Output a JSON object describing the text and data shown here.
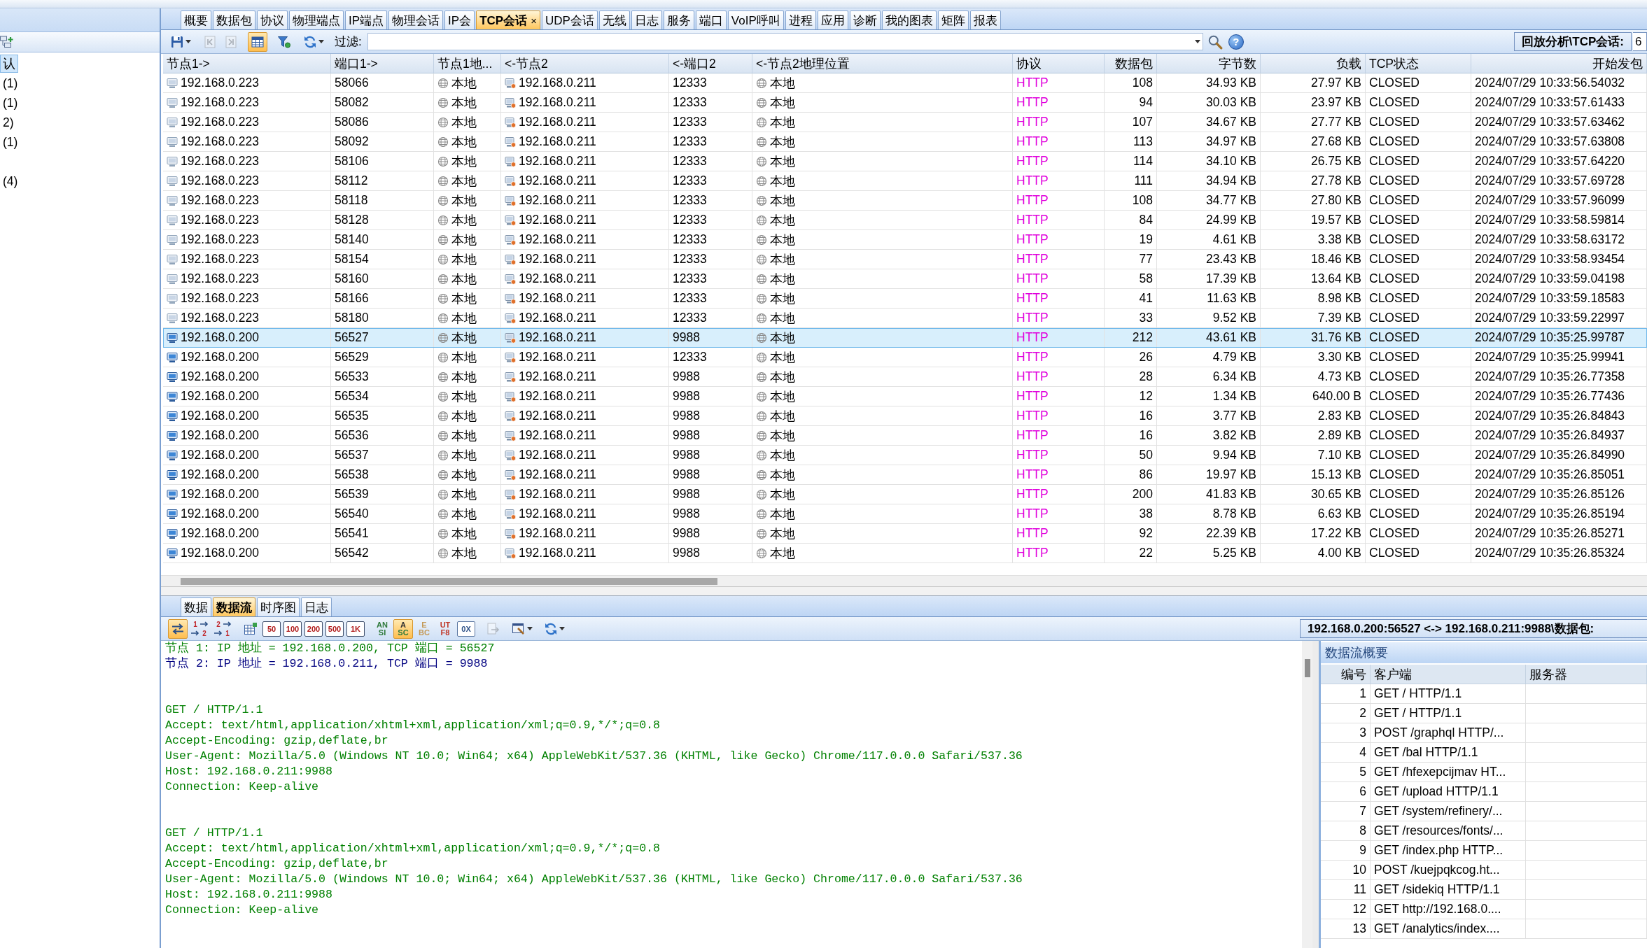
{
  "sidebar": {
    "items": [
      {
        "label": "认",
        "selected": true
      },
      {
        "label": "(1)",
        "selected": false
      },
      {
        "label": "(1)",
        "selected": false
      },
      {
        "label": "2)",
        "selected": false
      },
      {
        "label": "(1)",
        "selected": false
      },
      {
        "selected": false
      },
      {
        "label": "(4)",
        "selected": false
      }
    ]
  },
  "tabs": [
    {
      "label": "概要",
      "selected": false
    },
    {
      "label": "数据包",
      "selected": false
    },
    {
      "label": "协议",
      "selected": false
    },
    {
      "label": "物理端点",
      "selected": false
    },
    {
      "label": "IP端点",
      "selected": false
    },
    {
      "label": "物理会话",
      "selected": false
    },
    {
      "label": "IP会",
      "selected": false
    },
    {
      "label": "TCP会话",
      "selected": true,
      "close": "×"
    },
    {
      "label": "UDP会话",
      "selected": false
    },
    {
      "label": "无线",
      "selected": false
    },
    {
      "label": "日志",
      "selected": false
    },
    {
      "label": "服务",
      "selected": false
    },
    {
      "label": "端口",
      "selected": false
    },
    {
      "label": "VoIP呼叫",
      "selected": false
    },
    {
      "label": "进程",
      "selected": false
    },
    {
      "label": "应用",
      "selected": false
    },
    {
      "label": "诊断",
      "selected": false
    },
    {
      "label": "我的图表",
      "selected": false
    },
    {
      "label": "矩阵",
      "selected": false
    },
    {
      "label": "报表",
      "selected": false
    }
  ],
  "toolbar": {
    "buttons": [
      {
        "kind": "save",
        "on": false,
        "disabled": false
      },
      {
        "kind": "back",
        "on": false,
        "disabled": true
      },
      {
        "kind": "forward",
        "on": false,
        "disabled": true
      },
      {
        "kind": "table",
        "on": true,
        "disabled": false
      },
      {
        "kind": "filter",
        "on": false,
        "disabled": false
      },
      {
        "kind": "refresh",
        "on": false,
        "disabled": false
      }
    ],
    "filter_label": "过滤:",
    "tools": [
      {
        "kind": "search"
      },
      {
        "kind": "help",
        "label": "?"
      }
    ],
    "path": "回放分析\\TCP会话:",
    "value": "6"
  },
  "table": {
    "columns": [
      {
        "label": "节点1->",
        "kind": "source"
      },
      {
        "label": "端口1->",
        "kind": "port"
      },
      {
        "label": "节点1地...",
        "kind": "location"
      },
      {
        "label": "<-节点2",
        "kind": "target"
      },
      {
        "label": "<-端口2",
        "kind": "port"
      },
      {
        "label": "<-节点2地理位置",
        "kind": "location"
      },
      {
        "label": "协议",
        "kind": "protocol"
      },
      {
        "label": "数据包",
        "kind": "count"
      },
      {
        "label": "字节数",
        "kind": "count"
      },
      {
        "label": "负载",
        "kind": "count"
      },
      {
        "label": "TCP状态",
        "kind": "state"
      },
      {
        "label": "开始发包",
        "kind": "time"
      }
    ],
    "rows": [
      {
        "kind": "remote",
        "selected": false,
        "cells": [
          "192.168.0.223",
          "58066",
          "本地",
          "192.168.0.211",
          "12333",
          "本地",
          "HTTP",
          "108",
          "34.93 KB",
          "27.97 KB",
          "CLOSED",
          "2024/07/29 10:33:56.54032"
        ]
      },
      {
        "kind": "remote",
        "selected": false,
        "cells": [
          "192.168.0.223",
          "58082",
          "本地",
          "192.168.0.211",
          "12333",
          "本地",
          "HTTP",
          "94",
          "30.03 KB",
          "23.97 KB",
          "CLOSED",
          "2024/07/29 10:33:57.61433"
        ]
      },
      {
        "kind": "remote",
        "selected": false,
        "cells": [
          "192.168.0.223",
          "58086",
          "本地",
          "192.168.0.211",
          "12333",
          "本地",
          "HTTP",
          "107",
          "34.67 KB",
          "27.77 KB",
          "CLOSED",
          "2024/07/29 10:33:57.63462"
        ]
      },
      {
        "kind": "remote",
        "selected": false,
        "cells": [
          "192.168.0.223",
          "58092",
          "本地",
          "192.168.0.211",
          "12333",
          "本地",
          "HTTP",
          "113",
          "34.97 KB",
          "27.68 KB",
          "CLOSED",
          "2024/07/29 10:33:57.63808"
        ]
      },
      {
        "kind": "remote",
        "selected": false,
        "cells": [
          "192.168.0.223",
          "58106",
          "本地",
          "192.168.0.211",
          "12333",
          "本地",
          "HTTP",
          "114",
          "34.10 KB",
          "26.75 KB",
          "CLOSED",
          "2024/07/29 10:33:57.64220"
        ]
      },
      {
        "kind": "remote",
        "selected": false,
        "cells": [
          "192.168.0.223",
          "58112",
          "本地",
          "192.168.0.211",
          "12333",
          "本地",
          "HTTP",
          "111",
          "34.94 KB",
          "27.78 KB",
          "CLOSED",
          "2024/07/29 10:33:57.69728"
        ]
      },
      {
        "kind": "remote",
        "selected": false,
        "cells": [
          "192.168.0.223",
          "58118",
          "本地",
          "192.168.0.211",
          "12333",
          "本地",
          "HTTP",
          "108",
          "34.77 KB",
          "27.80 KB",
          "CLOSED",
          "2024/07/29 10:33:57.96099"
        ]
      },
      {
        "kind": "remote",
        "selected": false,
        "cells": [
          "192.168.0.223",
          "58128",
          "本地",
          "192.168.0.211",
          "12333",
          "本地",
          "HTTP",
          "84",
          "24.99 KB",
          "19.57 KB",
          "CLOSED",
          "2024/07/29 10:33:58.59814"
        ]
      },
      {
        "kind": "remote",
        "selected": false,
        "cells": [
          "192.168.0.223",
          "58140",
          "本地",
          "192.168.0.211",
          "12333",
          "本地",
          "HTTP",
          "19",
          "4.61 KB",
          "3.38 KB",
          "CLOSED",
          "2024/07/29 10:33:58.63172"
        ]
      },
      {
        "kind": "remote",
        "selected": false,
        "cells": [
          "192.168.0.223",
          "58154",
          "本地",
          "192.168.0.211",
          "12333",
          "本地",
          "HTTP",
          "77",
          "23.43 KB",
          "18.46 KB",
          "CLOSED",
          "2024/07/29 10:33:58.93454"
        ]
      },
      {
        "kind": "remote",
        "selected": false,
        "cells": [
          "192.168.0.223",
          "58160",
          "本地",
          "192.168.0.211",
          "12333",
          "本地",
          "HTTP",
          "58",
          "17.39 KB",
          "13.64 KB",
          "CLOSED",
          "2024/07/29 10:33:59.04198"
        ]
      },
      {
        "kind": "remote",
        "selected": false,
        "cells": [
          "192.168.0.223",
          "58166",
          "本地",
          "192.168.0.211",
          "12333",
          "本地",
          "HTTP",
          "41",
          "11.63 KB",
          "8.98 KB",
          "CLOSED",
          "2024/07/29 10:33:59.18583"
        ]
      },
      {
        "kind": "remote",
        "selected": false,
        "cells": [
          "192.168.0.223",
          "58180",
          "本地",
          "192.168.0.211",
          "12333",
          "本地",
          "HTTP",
          "33",
          "9.52 KB",
          "7.39 KB",
          "CLOSED",
          "2024/07/29 10:33:59.22997"
        ]
      },
      {
        "kind": "local",
        "selected": true,
        "cells": [
          "192.168.0.200",
          "56527",
          "本地",
          "192.168.0.211",
          "9988",
          "本地",
          "HTTP",
          "212",
          "43.61 KB",
          "31.76 KB",
          "CLOSED",
          "2024/07/29 10:35:25.99787"
        ]
      },
      {
        "kind": "local",
        "selected": false,
        "cells": [
          "192.168.0.200",
          "56529",
          "本地",
          "192.168.0.211",
          "12333",
          "本地",
          "HTTP",
          "26",
          "4.79 KB",
          "3.30 KB",
          "CLOSED",
          "2024/07/29 10:35:25.99941"
        ]
      },
      {
        "kind": "local",
        "selected": false,
        "cells": [
          "192.168.0.200",
          "56533",
          "本地",
          "192.168.0.211",
          "9988",
          "本地",
          "HTTP",
          "28",
          "6.34 KB",
          "4.73 KB",
          "CLOSED",
          "2024/07/29 10:35:26.77358"
        ]
      },
      {
        "kind": "local",
        "selected": false,
        "cells": [
          "192.168.0.200",
          "56534",
          "本地",
          "192.168.0.211",
          "9988",
          "本地",
          "HTTP",
          "12",
          "1.34 KB",
          "640.00 B",
          "CLOSED",
          "2024/07/29 10:35:26.77436"
        ]
      },
      {
        "kind": "local",
        "selected": false,
        "cells": [
          "192.168.0.200",
          "56535",
          "本地",
          "192.168.0.211",
          "9988",
          "本地",
          "HTTP",
          "16",
          "3.77 KB",
          "2.83 KB",
          "CLOSED",
          "2024/07/29 10:35:26.84843"
        ]
      },
      {
        "kind": "local",
        "selected": false,
        "cells": [
          "192.168.0.200",
          "56536",
          "本地",
          "192.168.0.211",
          "9988",
          "本地",
          "HTTP",
          "16",
          "3.82 KB",
          "2.89 KB",
          "CLOSED",
          "2024/07/29 10:35:26.84937"
        ]
      },
      {
        "kind": "local",
        "selected": false,
        "cells": [
          "192.168.0.200",
          "56537",
          "本地",
          "192.168.0.211",
          "9988",
          "本地",
          "HTTP",
          "50",
          "9.94 KB",
          "7.10 KB",
          "CLOSED",
          "2024/07/29 10:35:26.84990"
        ]
      },
      {
        "kind": "local",
        "selected": false,
        "cells": [
          "192.168.0.200",
          "56538",
          "本地",
          "192.168.0.211",
          "9988",
          "本地",
          "HTTP",
          "86",
          "19.97 KB",
          "15.13 KB",
          "CLOSED",
          "2024/07/29 10:35:26.85051"
        ]
      },
      {
        "kind": "local",
        "selected": false,
        "cells": [
          "192.168.0.200",
          "56539",
          "本地",
          "192.168.0.211",
          "9988",
          "本地",
          "HTTP",
          "200",
          "41.83 KB",
          "30.65 KB",
          "CLOSED",
          "2024/07/29 10:35:26.85126"
        ]
      },
      {
        "kind": "local",
        "selected": false,
        "cells": [
          "192.168.0.200",
          "56540",
          "本地",
          "192.168.0.211",
          "9988",
          "本地",
          "HTTP",
          "38",
          "8.78 KB",
          "6.63 KB",
          "CLOSED",
          "2024/07/29 10:35:26.85194"
        ]
      },
      {
        "kind": "local",
        "selected": false,
        "cells": [
          "192.168.0.200",
          "56541",
          "本地",
          "192.168.0.211",
          "9988",
          "本地",
          "HTTP",
          "92",
          "22.39 KB",
          "17.22 KB",
          "CLOSED",
          "2024/07/29 10:35:26.85271"
        ]
      },
      {
        "kind": "local",
        "selected": false,
        "cells": [
          "192.168.0.200",
          "56542",
          "本地",
          "192.168.0.211",
          "9988",
          "本地",
          "HTTP",
          "22",
          "5.25 KB",
          "4.00 KB",
          "CLOSED",
          "2024/07/29 10:35:26.85324"
        ]
      }
    ]
  },
  "detail": {
    "tabs": [
      {
        "label": "数据",
        "selected": false
      },
      {
        "label": "数据流",
        "selected": true
      },
      {
        "label": "时序图",
        "selected": false
      },
      {
        "label": "日志",
        "selected": false
      }
    ],
    "toolbar": {
      "buttons": [
        {
          "kind": "swap",
          "on": true,
          "disabled": false
        },
        {
          "kind": "direction",
          "lines": [
            "1",
            "2"
          ],
          "on": false,
          "disabled": false
        },
        {
          "kind": "direction",
          "lines": [
            "2",
            "1"
          ],
          "on": false,
          "disabled": false
        },
        {
          "kind": "grid",
          "on": false,
          "disabled": false
        },
        {
          "kind": "count",
          "label": "50",
          "on": false,
          "disabled": false
        },
        {
          "kind": "count",
          "label": "100",
          "on": false,
          "disabled": false
        },
        {
          "kind": "count",
          "label": "200",
          "on": false,
          "disabled": false
        },
        {
          "kind": "count",
          "label": "500",
          "on": false,
          "disabled": false
        },
        {
          "kind": "count",
          "label": "1K",
          "on": false,
          "disabled": false
        },
        {
          "kind": "ansi",
          "lines": [
            "AN",
            "SI"
          ],
          "on": false,
          "disabled": false
        },
        {
          "kind": "ascii",
          "lines": [
            "A",
            "SC"
          ],
          "on": true,
          "disabled": false
        },
        {
          "kind": "ebcdic",
          "lines": [
            "E",
            "BC"
          ],
          "on": false,
          "disabled": false
        },
        {
          "kind": "utf8",
          "lines": [
            "UT",
            "F8"
          ],
          "on": false,
          "disabled": false
        },
        {
          "kind": "hex",
          "label": "0X",
          "on": false,
          "disabled": false
        },
        {
          "kind": "export",
          "on": false,
          "disabled": true
        },
        {
          "kind": "tools",
          "on": false,
          "disabled": false
        },
        {
          "kind": "refresh",
          "on": false,
          "disabled": false
        }
      ]
    },
    "title": "192.168.0.200:56527 <-> 192.168.0.211:9988\\数据包:",
    "stream": {
      "header": [
        {
          "kind": "client",
          "text": "节点 1: IP 地址 = 192.168.0.200, TCP 端口 = 56527"
        },
        {
          "kind": "server",
          "text": "节点 2: IP 地址 = 192.168.0.211, TCP 端口 = 9988"
        }
      ],
      "messages": [
        {
          "kind": "client",
          "lines": [
            "GET / HTTP/1.1",
            "Accept: text/html,application/xhtml+xml,application/xml;q=0.9,*/*;q=0.8",
            "Accept-Encoding: gzip,deflate,br",
            "User-Agent: Mozilla/5.0 (Windows NT 10.0; Win64; x64) AppleWebKit/537.36 (KHTML, like Gecko) Chrome/117.0.0.0 Safari/537.36",
            "Host: 192.168.0.211:9988",
            "Connection: Keep-alive"
          ]
        },
        {
          "kind": "client",
          "lines": [
            "GET / HTTP/1.1",
            "Accept: text/html,application/xhtml+xml,application/xml;q=0.9,*/*;q=0.8",
            "Accept-Encoding: gzip,deflate,br",
            "User-Agent: Mozilla/5.0 (Windows NT 10.0; Win64; x64) AppleWebKit/537.36 (KHTML, like Gecko) Chrome/117.0.0.0 Safari/537.36",
            "Host: 192.168.0.211:9988",
            "Connection: Keep-alive"
          ]
        }
      ]
    },
    "summary": {
      "title": "数据流概要",
      "columns": [
        "编号",
        "客户端",
        "服务器"
      ],
      "rows": [
        {
          "number": "1",
          "client": "GET / HTTP/1.1"
        },
        {
          "number": "2",
          "client": "GET / HTTP/1.1"
        },
        {
          "number": "3",
          "client": "POST /graphql HTTP/..."
        },
        {
          "number": "4",
          "client": "GET /bal HTTP/1.1"
        },
        {
          "number": "5",
          "client": "GET /hfexepcijmav HT..."
        },
        {
          "number": "6",
          "client": "GET /upload HTTP/1.1"
        },
        {
          "number": "7",
          "client": "GET /system/refinery/..."
        },
        {
          "number": "8",
          "client": "GET /resources/fonts/..."
        },
        {
          "number": "9",
          "client": "GET /index.php HTTP..."
        },
        {
          "number": "10",
          "client": "POST /kuejpqkcog.ht..."
        },
        {
          "number": "11",
          "client": "GET /sidekiq HTTP/1.1"
        },
        {
          "number": "12",
          "client": "GET http://192.168.0...."
        },
        {
          "number": "13",
          "client": "GET /analytics/index...."
        }
      ]
    }
  }
}
